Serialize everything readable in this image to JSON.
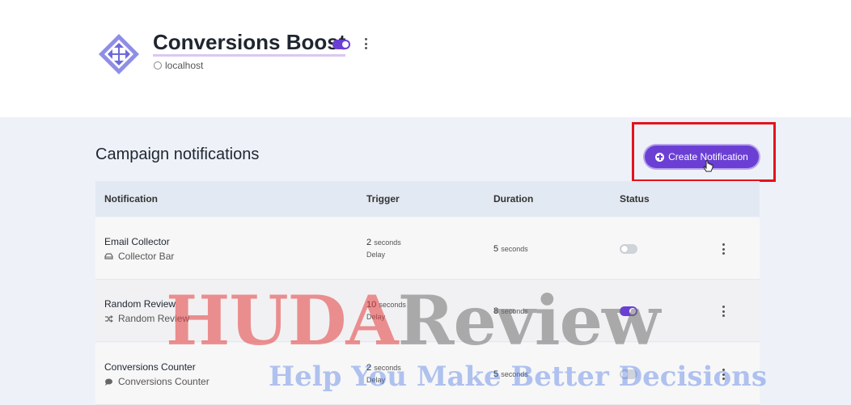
{
  "header": {
    "site_title": "Conversions Boost",
    "site_url": "localhost",
    "enabled": true
  },
  "campaign": {
    "section_title": "Campaign notifications",
    "create_button_label": "Create Notification"
  },
  "table": {
    "columns": [
      "Notification",
      "Trigger",
      "Duration",
      "Status"
    ],
    "rows": [
      {
        "name": "Email Collector",
        "type": "Collector Bar",
        "type_icon": "collector-bar-icon",
        "trigger_value": "2",
        "trigger_unit": "seconds",
        "trigger_label": "Delay",
        "duration_value": "5",
        "duration_unit": "seconds",
        "status_on": false
      },
      {
        "name": "Random Review",
        "type": "Random Review",
        "type_icon": "shuffle-icon",
        "trigger_value": "10",
        "trigger_unit": "seconds",
        "trigger_label": "Delay",
        "duration_value": "8",
        "duration_unit": "seconds",
        "status_on": true
      },
      {
        "name": "Conversions Counter",
        "type": "Conversions Counter",
        "type_icon": "chat-bubble-icon",
        "trigger_value": "2",
        "trigger_unit": "seconds",
        "trigger_label": "Delay",
        "duration_value": "5",
        "duration_unit": "seconds",
        "status_on": false
      }
    ]
  },
  "watermark": {
    "main_a": "HUDA",
    "main_b": "Review",
    "sub": "Help You Make Better Decisions"
  },
  "colors": {
    "accent": "#6b3fd4",
    "highlight": "#e2131e",
    "header_bg": "#ffffff",
    "page_bg": "#eef2f8"
  }
}
